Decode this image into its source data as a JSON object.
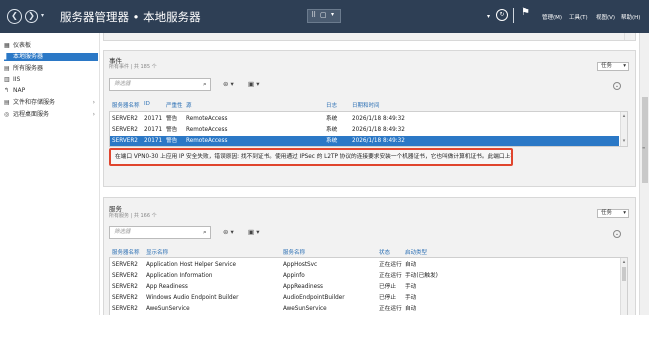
{
  "window": {
    "title": "服务器管理器 • 本地服务器",
    "back_glyph": "❮",
    "forward_glyph": "❯",
    "menu": [
      "管理(M)",
      "工具(T)",
      "视图(V)",
      "帮助(H)"
    ]
  },
  "sidebar": {
    "items": [
      {
        "label": "仪表板",
        "icon": "dashboard-icon",
        "glyph": "▦",
        "selected": false,
        "expandable": false
      },
      {
        "label": "本地服务器",
        "icon": "local-server-icon",
        "glyph": "▌",
        "selected": true,
        "expandable": false
      },
      {
        "label": "所有服务器",
        "icon": "all-servers-icon",
        "glyph": "▤",
        "selected": false,
        "expandable": false
      },
      {
        "label": "IIS",
        "icon": "iis-icon",
        "glyph": "▥",
        "selected": false,
        "expandable": false
      },
      {
        "label": "NAP",
        "icon": "nap-icon",
        "glyph": "↰",
        "selected": false,
        "expandable": false
      },
      {
        "label": "文件和存储服务",
        "icon": "file-storage-icon",
        "glyph": "▤",
        "selected": false,
        "expandable": true
      },
      {
        "label": "远程桌面服务",
        "icon": "remote-desktop-icon",
        "glyph": "◎",
        "selected": false,
        "expandable": true
      }
    ]
  },
  "events": {
    "title": "事件",
    "subtitle": "所有事件 | 共 185 个",
    "tasks_label": "任务",
    "filter_placeholder": "筛选器",
    "columns": [
      "服务器名称",
      "ID",
      "严重性",
      "源",
      "日志",
      "日期和时间"
    ],
    "rows": [
      {
        "server": "SERVER2",
        "id": "20171",
        "severity": "警告",
        "source": "RemoteAccess",
        "log": "系统",
        "datetime": "2026/1/18 8:49:32",
        "selected": false
      },
      {
        "server": "SERVER2",
        "id": "20171",
        "severity": "警告",
        "source": "RemoteAccess",
        "log": "系统",
        "datetime": "2026/1/18 8:49:32",
        "selected": false
      },
      {
        "server": "SERVER2",
        "id": "20171",
        "severity": "警告",
        "source": "RemoteAccess",
        "log": "系统",
        "datetime": "2026/1/18 8:49:32",
        "selected": true
      }
    ],
    "detail_message": "在端口 VPN0-30 上应用 IP 安全失败，错误原因: 找不到证书。使用通过 IPSec 的 L2TP 协议的连接要求安装一个机器证书，它也叫做计算机证书。此端口上不能接收到呼叫。"
  },
  "services": {
    "title": "服务",
    "subtitle": "所有服务 | 共 166 个",
    "tasks_label": "任务",
    "filter_placeholder": "筛选器",
    "columns": [
      "服务器名称",
      "显示名称",
      "服务名称",
      "状态",
      "启动类型"
    ],
    "rows": [
      {
        "server": "SERVER2",
        "display": "Application Host Helper Service",
        "service": "AppHostSvc",
        "status": "正在运行",
        "startup": "自动"
      },
      {
        "server": "SERVER2",
        "display": "Application Information",
        "service": "Appinfo",
        "status": "正在运行",
        "startup": "手动(已触发)"
      },
      {
        "server": "SERVER2",
        "display": "App Readiness",
        "service": "AppReadiness",
        "status": "已停止",
        "startup": "手动"
      },
      {
        "server": "SERVER2",
        "display": "Windows Audio Endpoint Builder",
        "service": "AudioEndpointBuilder",
        "status": "已停止",
        "startup": "手动"
      },
      {
        "server": "SERVER2",
        "display": "AweSunService",
        "service": "AweSunService",
        "status": "正在运行",
        "startup": "自动"
      }
    ]
  },
  "colors": {
    "titlebar_bg": "#2e3f55",
    "selection": "#2b78c6",
    "header_text": "#2b6fb4",
    "highlight_border": "#e0452e"
  }
}
